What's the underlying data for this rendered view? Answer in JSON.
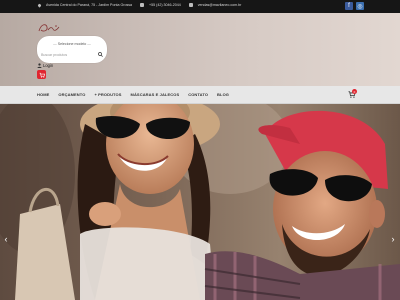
{
  "topbar": {
    "address": "Avenida Central do Paraná, 75 - Jardim Ponta Grossa",
    "phone": "+55 (42) 3046-2044",
    "email": "vendas@mavilaneo.com.br",
    "social": [
      "facebook-icon",
      "instagram-icon"
    ]
  },
  "header": {
    "logo_text": "Dinni",
    "select_placeholder": "Selecione modelo",
    "search_placeholder": "Buscar produtos",
    "login_label": "Login"
  },
  "nav": {
    "items": [
      "HOME",
      "ORÇAMENTO",
      "+ PRODUTOS",
      "MÁSCARAS E JALECOS",
      "CONTATO",
      "BLOG"
    ],
    "cart_count": "0"
  },
  "hero": {
    "prev_arrow": "‹",
    "next_arrow": "›"
  },
  "colors": {
    "topbar_bg": "#161616",
    "accent_red": "#e0252f",
    "nav_bg": "#e7e7e7",
    "facebook": "#3a5a9b"
  }
}
